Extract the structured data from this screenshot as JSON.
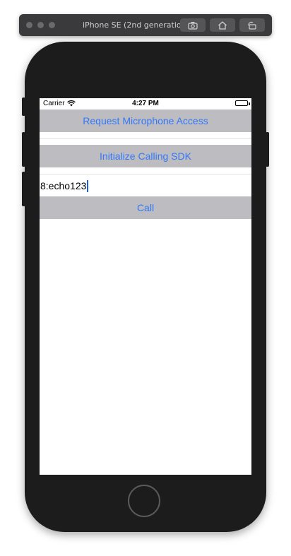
{
  "simulator": {
    "title": "iPhone SE (2nd generation) (13...",
    "buttons": [
      "screenshot-icon",
      "home-icon",
      "rotate-icon"
    ]
  },
  "status_bar": {
    "carrier": "Carrier",
    "time": "4:27 PM"
  },
  "app": {
    "request_mic_label": "Request Microphone Access",
    "init_sdk_label": "Initialize Calling SDK",
    "callee_value": "8:echo123",
    "call_label": "Call"
  },
  "colors": {
    "button_bg": "#bcbcc1",
    "button_text": "#3478f6",
    "phone_body": "#1c1c1c"
  }
}
